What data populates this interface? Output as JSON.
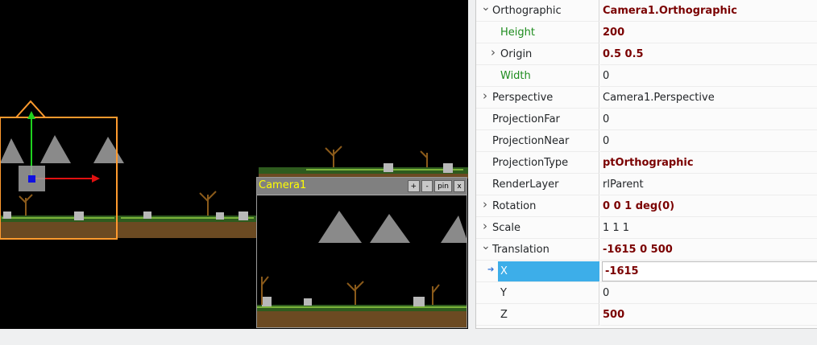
{
  "viewport": {
    "preview": {
      "title": "Camera1",
      "buttons": [
        "+",
        "-",
        "pin",
        "x"
      ]
    }
  },
  "inspector": {
    "rows": [
      {
        "name": "Orthographic",
        "value": "Camera1.Orthographic",
        "expander": "open",
        "indent": 0,
        "value_bold": true,
        "name_color": "normal"
      },
      {
        "name": "Height",
        "value": "200",
        "expander": "none",
        "indent": 1,
        "value_bold": true,
        "name_color": "green"
      },
      {
        "name": "Origin",
        "value": "0.5 0.5",
        "expander": "closed",
        "indent": 1,
        "value_bold": true,
        "name_color": "normal"
      },
      {
        "name": "Width",
        "value": "0",
        "expander": "none",
        "indent": 1,
        "value_bold": false,
        "name_color": "green"
      },
      {
        "name": "Perspective",
        "value": "Camera1.Perspective",
        "expander": "closed",
        "indent": 0,
        "value_bold": false,
        "name_color": "normal"
      },
      {
        "name": "ProjectionFar",
        "value": "0",
        "expander": "none",
        "indent": 0,
        "value_bold": false,
        "name_color": "normal"
      },
      {
        "name": "ProjectionNear",
        "value": "0",
        "expander": "none",
        "indent": 0,
        "value_bold": false,
        "name_color": "normal"
      },
      {
        "name": "ProjectionType",
        "value": "ptOrthographic",
        "expander": "none",
        "indent": 0,
        "value_bold": true,
        "name_color": "normal"
      },
      {
        "name": "RenderLayer",
        "value": "rlParent",
        "expander": "none",
        "indent": 0,
        "value_bold": false,
        "name_color": "normal"
      },
      {
        "name": "Rotation",
        "value": "0 0 1 deg(0)",
        "expander": "closed",
        "indent": 0,
        "value_bold": true,
        "name_color": "normal"
      },
      {
        "name": "Scale",
        "value": "1 1 1",
        "expander": "closed",
        "indent": 0,
        "value_bold": false,
        "name_color": "normal"
      },
      {
        "name": "Translation",
        "value": "-1615 0 500",
        "expander": "open",
        "indent": 0,
        "value_bold": true,
        "name_color": "normal"
      },
      {
        "name": "X",
        "value": "-1615",
        "expander": "none",
        "indent": 1,
        "value_bold": true,
        "name_color": "normal",
        "selected": true,
        "editing": true
      },
      {
        "name": "Y",
        "value": "0",
        "expander": "none",
        "indent": 1,
        "value_bold": false,
        "name_color": "normal"
      },
      {
        "name": "Z",
        "value": "500",
        "expander": "none",
        "indent": 1,
        "value_bold": true,
        "name_color": "normal"
      }
    ]
  },
  "colors": {
    "selection": "#3daee9",
    "modified_value": "#7a0000",
    "default_name": "#1e8c1e",
    "gizmo_frame": "#ff9a2e"
  }
}
